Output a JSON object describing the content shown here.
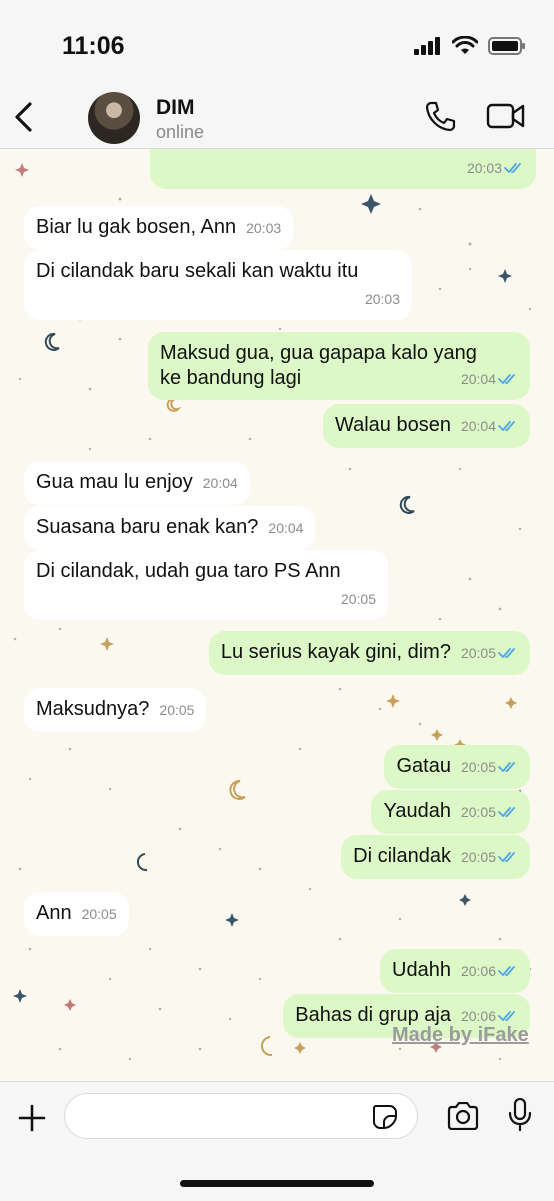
{
  "status_bar": {
    "time": "11:06"
  },
  "header": {
    "name": "DIM",
    "status": "online"
  },
  "messages": [
    {
      "text": "Biar lu gak bosen, Ann",
      "time": "20:03"
    },
    {
      "text": "Di cilandak baru sekali kan waktu itu",
      "time": "20:03"
    },
    {
      "line1": "Maksud gua, gua gapapa kalo yang",
      "line2": "ke bandung lagi",
      "time": "20:04"
    },
    {
      "text": "Walau bosen",
      "time": "20:04"
    },
    {
      "text": "Gua mau lu enjoy",
      "time": "20:04"
    },
    {
      "text": "Suasana baru enak kan?",
      "time": "20:04"
    },
    {
      "text": "Di cilandak, udah gua taro PS Ann",
      "time": "20:05"
    },
    {
      "text": "Lu serius kayak gini, dim?",
      "time": "20:05"
    },
    {
      "text": "Maksudnya?",
      "time": "20:05"
    },
    {
      "text": "Gatau",
      "time": "20:05"
    },
    {
      "text": "Yaudah",
      "time": "20:05"
    },
    {
      "text": "Di cilandak",
      "time": "20:05"
    },
    {
      "text": "Ann",
      "time": "20:05"
    },
    {
      "text": "Udahh",
      "time": "20:06"
    },
    {
      "text": "Bahas di grup aja",
      "time": "20:06"
    }
  ],
  "top_partial_message": {
    "time": "20:03"
  },
  "watermark": "Made by iFake",
  "colors": {
    "outgoing_bubble": "#dcf8c6",
    "incoming_bubble": "#ffffff",
    "read_tick": "#4fa6e6"
  }
}
